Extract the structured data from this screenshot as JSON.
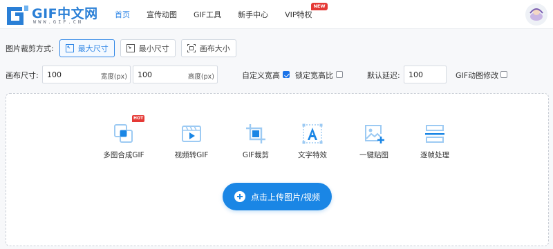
{
  "brand": {
    "name": "GIF中文网",
    "domain": "WWW.GIF.CN",
    "color": "#2a7fd6"
  },
  "nav": {
    "items": [
      {
        "label": "首页",
        "active": true
      },
      {
        "label": "宣传动图",
        "active": false
      },
      {
        "label": "GIF工具",
        "active": false
      },
      {
        "label": "新手中心",
        "active": false
      },
      {
        "label": "VIP特权",
        "active": false,
        "badge": "NEW"
      }
    ]
  },
  "crop": {
    "label": "图片裁剪方式:",
    "modes": [
      {
        "label": "最大尺寸",
        "icon": "expand-icon",
        "selected": true
      },
      {
        "label": "最小尺寸",
        "icon": "shrink-icon",
        "selected": false
      },
      {
        "label": "画布大小",
        "icon": "canvas-icon",
        "selected": false
      }
    ]
  },
  "size": {
    "label": "画布尺寸:",
    "width": {
      "value": "100",
      "unit": "宽度(px)"
    },
    "height": {
      "value": "100",
      "unit": "高度(px)"
    },
    "custom": {
      "label": "自定义宽高",
      "checked": true
    },
    "lock": {
      "label": "锁定宽高比",
      "checked": false
    },
    "delay": {
      "label": "默认延迟:",
      "value": "100"
    },
    "gif_edit": {
      "label": "GIF动图修改",
      "checked": false
    }
  },
  "tools": [
    {
      "label": "多图合成GIF",
      "icon": "merge-images-icon",
      "badge": "HOT"
    },
    {
      "label": "视频转GIF",
      "icon": "video-icon"
    },
    {
      "label": "GIF裁剪",
      "icon": "crop-icon"
    },
    {
      "label": "文字特效",
      "icon": "text-effect-icon"
    },
    {
      "label": "一键贴图",
      "icon": "add-image-icon"
    },
    {
      "label": "逐帧处理",
      "icon": "frames-icon"
    }
  ],
  "upload": {
    "label": "点击上传图片/视频",
    "icon": "plus-circle-icon"
  },
  "colors": {
    "accent": "#1a86e5",
    "badge": "#e53935",
    "icon_light": "#9ccaf3"
  }
}
